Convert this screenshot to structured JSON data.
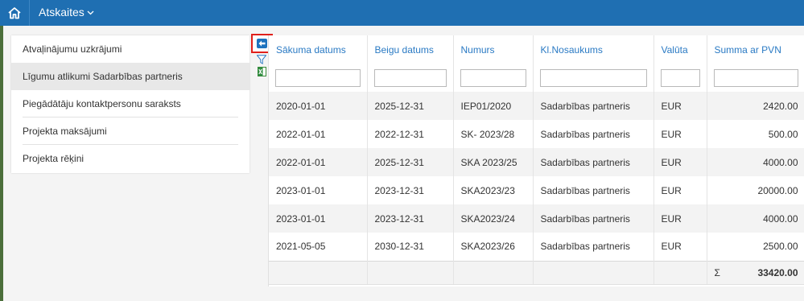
{
  "header": {
    "title": "Atskaites"
  },
  "sidebar": {
    "items": [
      {
        "label": "Atvaļinājumu uzkrājumi"
      },
      {
        "label": "Līgumu atlikumi Sadarbības partneris"
      },
      {
        "label": "Piegādātāju kontaktpersonu saraksts"
      },
      {
        "label": "Projekta maksājumi"
      },
      {
        "label": "Projekta rēķini"
      }
    ]
  },
  "table": {
    "columns": [
      "Sākuma datums",
      "Beigu datums",
      "Numurs",
      "Kl.Nosaukums",
      "Valūta",
      "Summa ar PVN"
    ],
    "rows": [
      [
        "2020-01-01",
        "2025-12-31",
        "IEP01/2020",
        "Sadarbības partneris",
        "EUR",
        "2420.00"
      ],
      [
        "2022-01-01",
        "2022-12-31",
        "SK- 2023/28",
        "Sadarbības partneris",
        "EUR",
        "500.00"
      ],
      [
        "2022-01-01",
        "2025-12-31",
        "SKA 2023/25",
        "Sadarbības partneris",
        "EUR",
        "4000.00"
      ],
      [
        "2023-01-01",
        "2023-12-31",
        "SKA2023/23",
        "Sadarbības partneris",
        "EUR",
        "20000.00"
      ],
      [
        "2023-01-01",
        "2023-12-31",
        "SKA2023/24",
        "Sadarbības partneris",
        "EUR",
        "4000.00"
      ],
      [
        "2021-05-05",
        "2030-12-31",
        "SKA2023/26",
        "Sadarbības partneris",
        "EUR",
        "2500.00"
      ]
    ],
    "total_symbol": "Σ",
    "total": "33420.00"
  },
  "icons": {
    "home": "home-icon",
    "back": "arrow-left-icon",
    "filter": "filter-icon",
    "export": "excel-icon"
  },
  "colors": {
    "header_bg": "#1f6fb2",
    "link": "#2a7ac4",
    "highlight": "#e0201b"
  }
}
